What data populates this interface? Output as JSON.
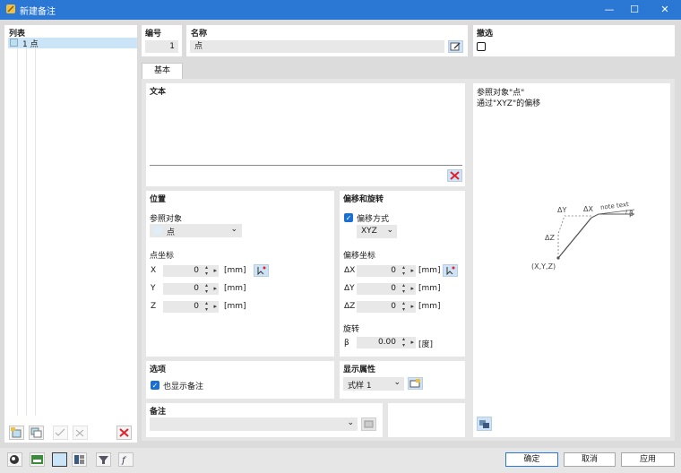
{
  "window": {
    "title": "新建备注",
    "minimize": "—",
    "maximize": "☐",
    "close": "✕"
  },
  "list": {
    "title": "列表",
    "items": [
      {
        "label": "1 点"
      }
    ]
  },
  "number": {
    "title": "编号",
    "value": "1"
  },
  "name": {
    "title": "名称",
    "value": "点"
  },
  "deactivate": {
    "title": "撤选"
  },
  "tabs": [
    {
      "label": "基本"
    }
  ],
  "text": {
    "title": "文本"
  },
  "position": {
    "title": "位置",
    "ref_label": "参照对象",
    "ref_value": "点",
    "coord_title": "点坐标",
    "coords": [
      {
        "axis": "X",
        "value": "0",
        "unit": "[mm]"
      },
      {
        "axis": "Y",
        "value": "0",
        "unit": "[mm]"
      },
      {
        "axis": "Z",
        "value": "0",
        "unit": "[mm]"
      }
    ]
  },
  "offset": {
    "title": "偏移和旋转",
    "offset_type_label": "偏移方式",
    "offset_type_value": "XYZ",
    "coord_title": "偏移坐标",
    "coords": [
      {
        "axis": "ΔX",
        "value": "0",
        "unit": "[mm]"
      },
      {
        "axis": "ΔY",
        "value": "0",
        "unit": "[mm]"
      },
      {
        "axis": "ΔZ",
        "value": "0",
        "unit": "[mm]"
      }
    ],
    "rotation_title": "旋转",
    "rotation": {
      "axis": "β",
      "value": "0.00",
      "unit": "[度]"
    }
  },
  "options": {
    "title": "选项",
    "show_also": "也显示备注"
  },
  "display": {
    "title": "显示属性",
    "style_value": "式样 1"
  },
  "comment": {
    "title": "备注"
  },
  "info": {
    "line1": "参照对象\"点\"",
    "line2": "通过\"XYZ\"的偏移"
  },
  "diagram": {
    "dy": "ΔY",
    "dx": "ΔX",
    "dz": "ΔZ",
    "note": "note text",
    "beta": "β",
    "origin": "(X,Y,Z)"
  },
  "footer": {
    "ok": "确定",
    "cancel": "取消",
    "apply": "应用"
  },
  "colors": {
    "accent": "#2b78d4",
    "delete": "#e0202a",
    "selection": "#cce4f7"
  }
}
